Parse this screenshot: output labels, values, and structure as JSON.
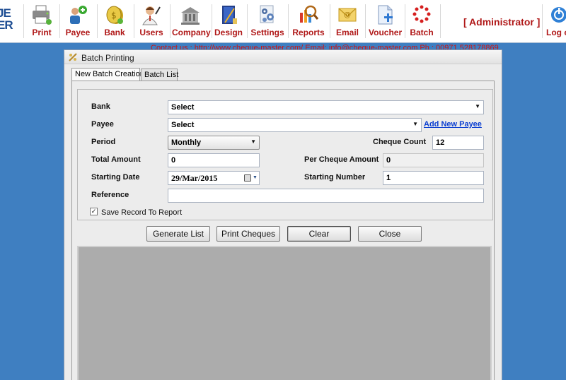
{
  "toolbar": {
    "logo_lines": [
      "JE",
      "ER"
    ],
    "items": [
      {
        "label": "Print",
        "icon": "printer-icon"
      },
      {
        "label": "Payee",
        "icon": "payee-icon"
      },
      {
        "label": "Bank",
        "icon": "bank-coin-icon"
      },
      {
        "label": "Users",
        "icon": "users-icon"
      },
      {
        "label": "Company",
        "icon": "company-building-icon"
      },
      {
        "label": "Design",
        "icon": "design-book-icon"
      },
      {
        "label": "Settings",
        "icon": "settings-gears-icon"
      },
      {
        "label": "Reports",
        "icon": "reports-magnifier-icon"
      },
      {
        "label": "Email",
        "icon": "email-envelope-icon"
      },
      {
        "label": "Voucher",
        "icon": "voucher-document-icon"
      },
      {
        "label": "Batch",
        "icon": "batch-burst-icon"
      },
      {
        "label": "Log o",
        "icon": "logout-icon"
      }
    ],
    "admin_label": "[ Administrator ]",
    "accent": "#b01818"
  },
  "contact_text": "Contact us : http://www.cheque-master.com/  Email: info@cheque-master.com   Ph : 00971 528178869",
  "dialog": {
    "title": "Batch Printing",
    "tabs": [
      {
        "label": "New Batch Creation",
        "active": true
      },
      {
        "label": "Batch List",
        "active": false
      }
    ],
    "form": {
      "bank_label": "Bank",
      "bank_value": "Select",
      "payee_label": "Payee",
      "payee_value": "Select",
      "add_payee_link": "Add New Payee",
      "period_label": "Period",
      "period_value": "Monthly",
      "cheque_count_label": "Cheque Count",
      "cheque_count_value": "12",
      "total_amount_label": "Total Amount",
      "total_amount_value": "0",
      "per_cheque_label": "Per Cheque Amount",
      "per_cheque_value": "0",
      "starting_date_label": "Starting Date",
      "starting_date_value": "29/Mar/2015",
      "starting_number_label": "Starting Number",
      "starting_number_value": "1",
      "reference_label": "Reference",
      "reference_value": "",
      "save_record_label": "Save Record To Report",
      "save_record_checked": true
    },
    "buttons": {
      "generate": "Generate List",
      "print": "Print Cheques",
      "clear": "Clear",
      "close": "Close"
    }
  }
}
